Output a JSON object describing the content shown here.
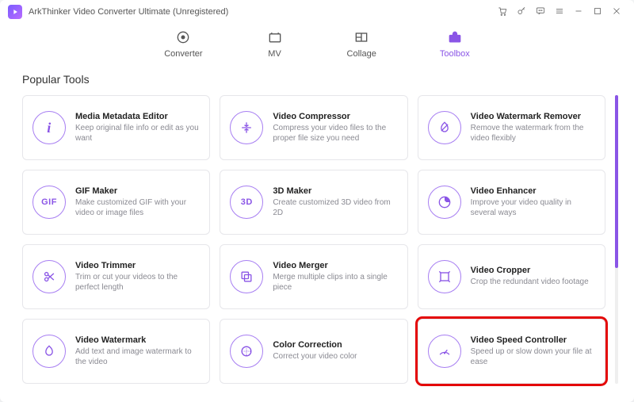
{
  "window": {
    "title": "ArkThinker Video Converter Ultimate (Unregistered)"
  },
  "nav": {
    "converter": "Converter",
    "mv": "MV",
    "collage": "Collage",
    "toolbox": "Toolbox"
  },
  "section": {
    "popular_tools": "Popular Tools"
  },
  "tools": {
    "metadata": {
      "title": "Media Metadata Editor",
      "desc": "Keep original file info or edit as you want",
      "icon_label": "i"
    },
    "compressor": {
      "title": "Video Compressor",
      "desc": "Compress your video files to the proper file size you need"
    },
    "watermark_remover": {
      "title": "Video Watermark Remover",
      "desc": "Remove the watermark from the video flexibly"
    },
    "gif": {
      "title": "GIF Maker",
      "desc": "Make customized GIF with your video or image files",
      "icon_label": "GIF"
    },
    "threeD": {
      "title": "3D Maker",
      "desc": "Create customized 3D video from 2D",
      "icon_label": "3D"
    },
    "enhancer": {
      "title": "Video Enhancer",
      "desc": "Improve your video quality in several ways"
    },
    "trimmer": {
      "title": "Video Trimmer",
      "desc": "Trim or cut your videos to the perfect length"
    },
    "merger": {
      "title": "Video Merger",
      "desc": "Merge multiple clips into a single piece"
    },
    "cropper": {
      "title": "Video Cropper",
      "desc": "Crop the redundant video footage"
    },
    "watermark": {
      "title": "Video Watermark",
      "desc": "Add text and image watermark to the video"
    },
    "color": {
      "title": "Color Correction",
      "desc": "Correct your video color"
    },
    "speed": {
      "title": "Video Speed Controller",
      "desc": "Speed up or slow down your file at ease"
    }
  }
}
